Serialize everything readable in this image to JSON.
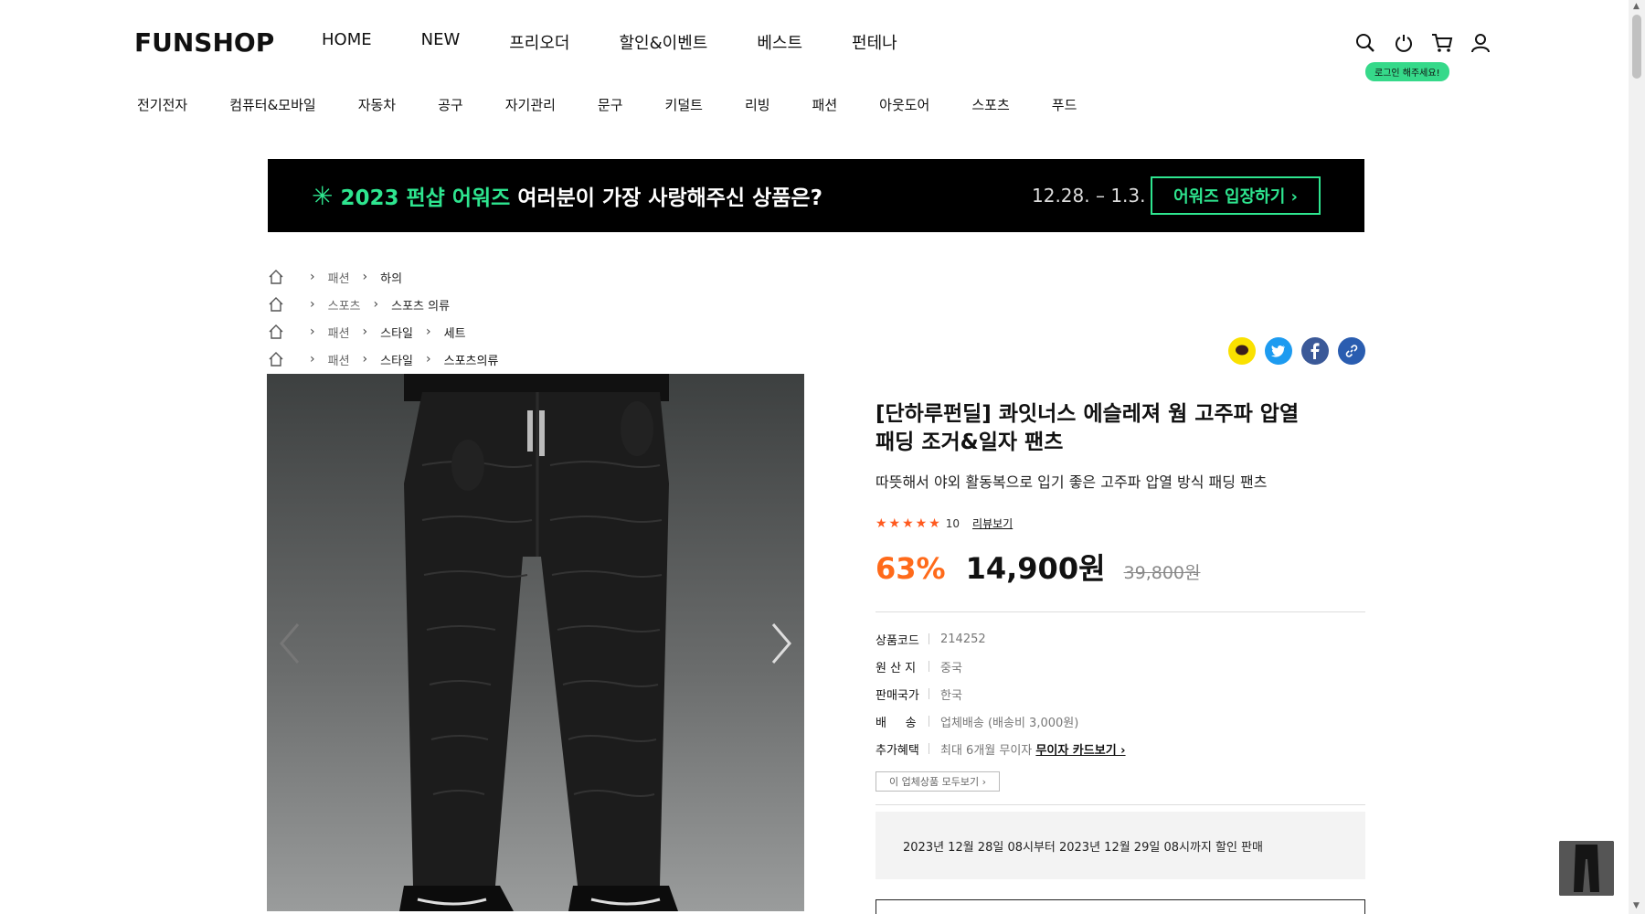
{
  "header": {
    "logo": "FUNSHOP",
    "nav": [
      "HOME",
      "NEW",
      "프리오더",
      "할인&이벤트",
      "베스트",
      "펀테나"
    ],
    "login_badge": "로그인 해주세요!",
    "icons": [
      "search-icon",
      "power-icon",
      "cart-icon",
      "user-icon"
    ]
  },
  "categories": [
    "전기전자",
    "컴퓨터&모바일",
    "자동차",
    "공구",
    "자기관리",
    "문구",
    "키덜트",
    "리빙",
    "패션",
    "아웃도어",
    "스포츠",
    "푸드"
  ],
  "banner": {
    "highlight": "2023 펀샵 어워즈",
    "text": "여러분이 가장 사랑해주신 상품은?",
    "date": "12.28. – 1.3.",
    "button": "어워즈 입장하기 ›"
  },
  "breadcrumbs": [
    [
      "패션",
      "하의"
    ],
    [
      "스포츠",
      "스포츠 의류"
    ],
    [
      "패션",
      "스타일",
      "세트"
    ],
    [
      "패션",
      "스타일",
      "스포츠의류"
    ]
  ],
  "product": {
    "title_line1": "[단하루펀딜] 콰잇너스 에슬레져 웜 고주파 압열",
    "title_line2": "패딩 조거&일자 팬츠",
    "subtitle": "따뜻해서 야외 활동복으로 입기 좋은 고주파 압열 방식 패딩 팬츠",
    "rating": 5,
    "stars": "★★★★★",
    "review_count": "10",
    "review_link": "리뷰보기",
    "discount": "63%",
    "price": "14,900원",
    "original_price": "39,800원",
    "specs": [
      {
        "key": "상품코드",
        "value": "214252"
      },
      {
        "key": "원 산 지",
        "value": "중국"
      },
      {
        "key": "판매국가",
        "value": "한국"
      },
      {
        "key": "배     송",
        "value": "업체배송 (배송비 3,000원)"
      },
      {
        "key": "추가혜택",
        "value": "최대 6개월 무이자",
        "link": "무이자 카드보기 ›"
      }
    ],
    "all_products_button": "이 업체상품 모두보기 ›",
    "sale_period": "2023년 12월 28일 08시부터 2023년 12월 29일 08시까지 할인 판매"
  },
  "colors": {
    "accent_green": "#2ee58f",
    "discount_orange": "#ff6a1a",
    "star": "#ff5a1f",
    "kakao": "#fae100",
    "twitter": "#1d9bf0",
    "facebook": "#3b5998",
    "link": "#2a5db0"
  }
}
